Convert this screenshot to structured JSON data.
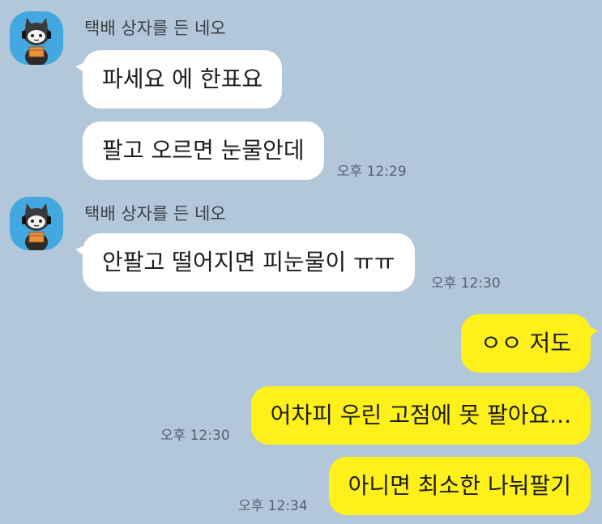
{
  "colors": {
    "background": "#b2c7d9",
    "incoming_bubble": "#ffffff",
    "outgoing_bubble": "#fef01b",
    "avatar_bg": "#43a8e0"
  },
  "messages": {
    "group1": {
      "sender": "택배 상자를 든 네오",
      "avatar_icon": "neo-with-box-avatar",
      "msg1": "파세요 에 한표요",
      "msg2": "팔고 오르면 눈물안데",
      "time": "오후 12:29"
    },
    "group2": {
      "sender": "택배 상자를 든 네오",
      "avatar_icon": "neo-with-box-avatar",
      "msg1": "안팔고 떨어지면 피눈물이 ㅠㅠ",
      "time": "오후 12:30"
    },
    "outgoing": {
      "msg1": "ㅇㅇ 저도",
      "msg2": "어차피 우린 고점에 못 팔아요...",
      "msg2_time": "오후 12:30",
      "msg3": "아니면 최소한 나눠팔기",
      "msg3_time": "오후 12:34"
    }
  }
}
